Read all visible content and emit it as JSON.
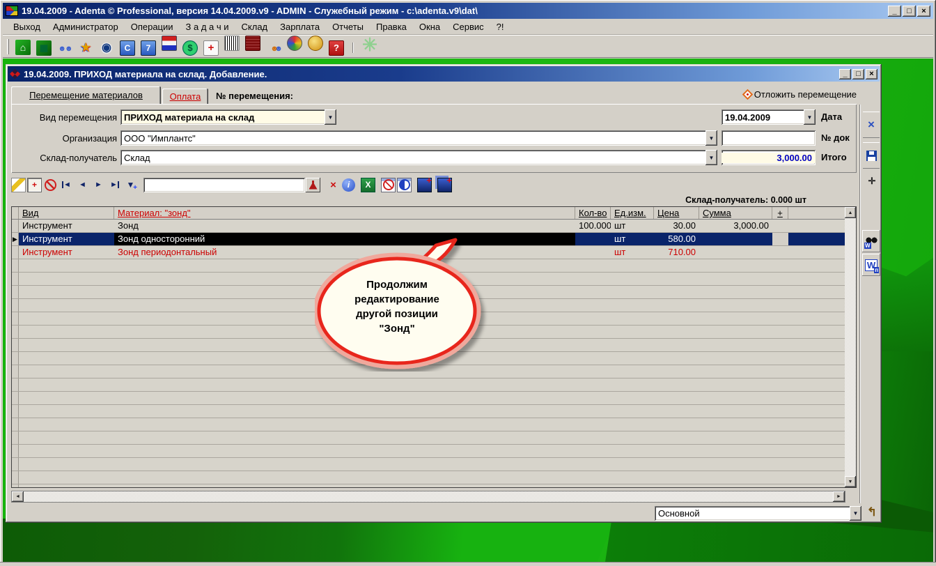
{
  "window": {
    "title": "19.04.2009 - Adenta © Professional, версия 14.04.2009.v9 - ADMIN - Служебный режим - c:\\adenta.v9\\dat\\",
    "controls": {
      "minimize": "_",
      "maximize": "□",
      "close": "×"
    }
  },
  "menu": {
    "items": [
      "Выход",
      "Администратор",
      "Операции",
      "З а д а ч и",
      "Склад",
      "Зарплата",
      "Отчеты",
      "Правка",
      "Окна",
      "Сервис",
      "?!"
    ]
  },
  "toolbar": {
    "icons": [
      "exit-icon",
      "database-icon",
      "patients-icon",
      "events-icon",
      "schedule-icon",
      "calendar-c-icon",
      "calendar-7-icon",
      "flags-icon",
      "money-icon",
      "firstaid-icon",
      "barcode-icon",
      "cashbox-icon",
      "staff-icon",
      "palette-icon",
      "gold-icon",
      "help-icon"
    ],
    "extra_icon": "settings-flower-icon"
  },
  "colors": {
    "titlebar_start": "#0a246a",
    "titlebar_end": "#a8c8f0",
    "selection_blue": "#0a246a",
    "highlight_field": "#fffbe6",
    "total_text_blue": "#0000c0",
    "alert_red": "#cc0000",
    "desktop_green": "#16b30c",
    "bubble_border_red": "#e8281e"
  },
  "dialog": {
    "title": "19.04.2009. ПРИХОД материала на склад. Добавление.",
    "tabs": [
      {
        "label": "Перемещение материалов",
        "active": true
      },
      {
        "label": "Оплата",
        "active": false
      }
    ],
    "transfer_label": "№ перемещения:",
    "defer_action": "Отложить перемещение",
    "form": {
      "rows": [
        {
          "label": "Вид перемещения",
          "value": "ПРИХОД материала на склад",
          "r_label": "Дата",
          "r_value": "19.04.2009"
        },
        {
          "label": "Организация",
          "value": "ООО \"Имплантс\"",
          "r_label": "№ док",
          "r_value": ""
        },
        {
          "label": "Склад-получатель",
          "value": "Склад",
          "r_label": "Итого",
          "r_value": "3,000.00"
        }
      ]
    },
    "grid_toolbar": {
      "left_icons": [
        "edit-record-icon",
        "add-record-icon",
        "cancel-record-icon",
        "first-record-icon",
        "prior-record-icon",
        "next-record-icon",
        "last-record-icon",
        "filter-icon"
      ],
      "search_value": "",
      "right_icons": [
        "flask-icon",
        "clear-filter-icon",
        "info-icon",
        "excel-export-icon",
        "hide-columns-icon",
        "show-columns-icon",
        "insert-position-icon",
        "copy-position-icon"
      ]
    },
    "grid_caption": "Склад-получатель: 0.000 шт",
    "table": {
      "columns": [
        {
          "label": "Вид",
          "red": false
        },
        {
          "label": "Материал: \"зонд\"",
          "red": true
        },
        {
          "label": "Кол-во",
          "red": false
        },
        {
          "label": "Ед.изм.",
          "red": false
        },
        {
          "label": "Цена",
          "red": false
        },
        {
          "label": "Сумма",
          "red": false
        },
        {
          "label": "+",
          "red": false
        },
        {
          "label": "",
          "red": false
        }
      ],
      "rows": [
        {
          "state": "normal",
          "cells": [
            "Инструмент",
            "Зонд",
            "100.000",
            "шт",
            "30.00",
            "3,000.00",
            "",
            ""
          ]
        },
        {
          "state": "selected",
          "cells": [
            "Инструмент",
            "Зонд односторонний",
            "",
            "шт",
            "580.00",
            "",
            "",
            ""
          ]
        },
        {
          "state": "red",
          "cells": [
            "Инструмент",
            "Зонд периодонтальный",
            "",
            "шт",
            "710.00",
            "",
            "",
            ""
          ]
        }
      ]
    },
    "bubble": {
      "lines": [
        "Продолжим",
        "редактирование",
        "другой позиции",
        "\"Зонд\""
      ]
    },
    "footer": {
      "combo_value": "Основной"
    }
  }
}
